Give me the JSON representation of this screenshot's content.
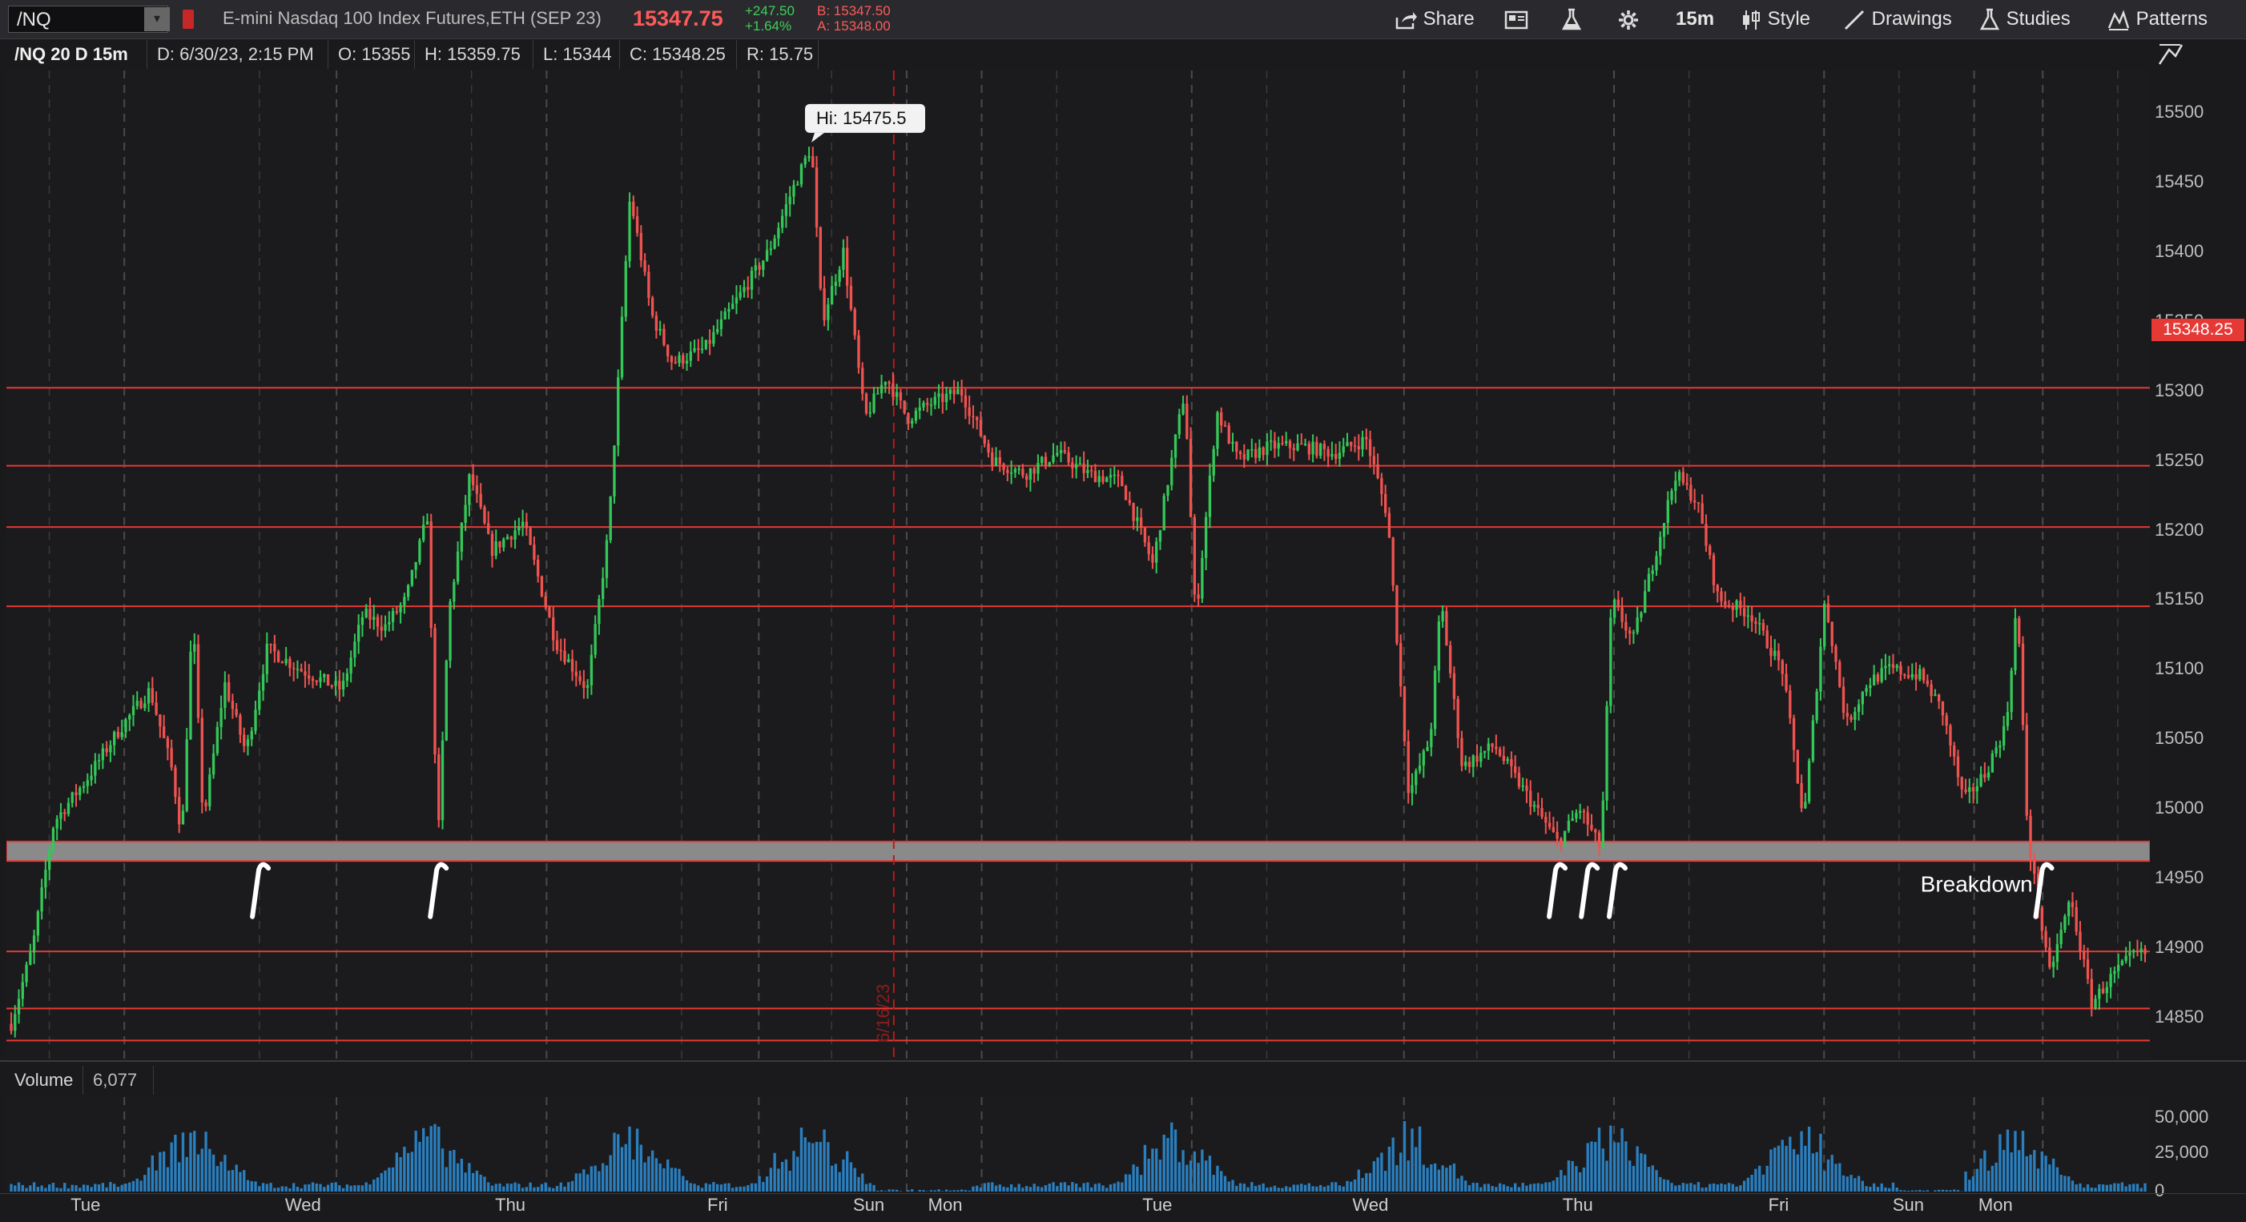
{
  "toolbar": {
    "symbol": "/NQ",
    "description": "E-mini Nasdaq 100 Index Futures,ETH (SEP 23)",
    "last_price": "15347.75",
    "net_change": "+247.50",
    "pct_change": "+1.64%",
    "bid": "B: 15347.50",
    "ask": "A: 15348.00",
    "share_label": "Share",
    "timeframe_label": "15m",
    "style_label": "Style",
    "drawings_label": "Drawings",
    "studies_label": "Studies",
    "patterns_label": "Patterns"
  },
  "info": {
    "chart_label": "/NQ 20 D 15m",
    "date": "D: 6/30/23, 2:15 PM",
    "open": "O: 15355",
    "high": "H: 15359.75",
    "low": "L: 15344",
    "close": "C: 15348.25",
    "range": "R: 15.75"
  },
  "volume_pane": {
    "label": "Volume",
    "value": "6,077",
    "axis_labels": [
      "50,000",
      "25,000",
      "0"
    ]
  },
  "chart_data": {
    "type": "candlestick",
    "price_axis": [
      "15500",
      "15450",
      "15400",
      "15350",
      "15300",
      "15250",
      "15200",
      "15150",
      "15100",
      "15050",
      "15000",
      "14950",
      "14900",
      "14850"
    ],
    "ylim": [
      14820,
      15530
    ],
    "current_price_label": "15348.25",
    "day_labels": [
      "Tue",
      "Wed",
      "Thu",
      "Fri",
      "Sun",
      "Mon",
      "Tue",
      "Wed",
      "Thu",
      "Fri",
      "Sun",
      "Mon"
    ],
    "horizontal_levels": [
      15302,
      15246,
      15202,
      15145,
      14897,
      14856,
      14833
    ],
    "support_zone": [
      14962,
      14976
    ],
    "session_marker": "6/16/23",
    "high_annotation": "Hi: 15475.5",
    "annotations": [
      "Breakdown"
    ],
    "path_points": [
      [
        0,
        14845
      ],
      [
        0.01,
        14900
      ],
      [
        0.02,
        14990
      ],
      [
        0.035,
        15020
      ],
      [
        0.05,
        15055
      ],
      [
        0.065,
        15085
      ],
      [
        0.075,
        15030
      ],
      [
        0.08,
        14980
      ],
      [
        0.085,
        15140
      ],
      [
        0.09,
        14990
      ],
      [
        0.1,
        15090
      ],
      [
        0.11,
        15040
      ],
      [
        0.12,
        15115
      ],
      [
        0.135,
        15100
      ],
      [
        0.155,
        15085
      ],
      [
        0.165,
        15140
      ],
      [
        0.175,
        15130
      ],
      [
        0.185,
        15150
      ],
      [
        0.195,
        15210
      ],
      [
        0.2,
        14975
      ],
      [
        0.205,
        15140
      ],
      [
        0.215,
        15240
      ],
      [
        0.225,
        15185
      ],
      [
        0.24,
        15205
      ],
      [
        0.255,
        15120
      ],
      [
        0.27,
        15085
      ],
      [
        0.28,
        15200
      ],
      [
        0.29,
        15440
      ],
      [
        0.3,
        15355
      ],
      [
        0.31,
        15320
      ],
      [
        0.325,
        15330
      ],
      [
        0.34,
        15365
      ],
      [
        0.355,
        15400
      ],
      [
        0.365,
        15440
      ],
      [
        0.375,
        15476
      ],
      [
        0.38,
        15350
      ],
      [
        0.39,
        15400
      ],
      [
        0.4,
        15280
      ],
      [
        0.41,
        15310
      ],
      [
        0.42,
        15280
      ],
      [
        0.43,
        15290
      ],
      [
        0.445,
        15300
      ],
      [
        0.46,
        15250
      ],
      [
        0.475,
        15240
      ],
      [
        0.49,
        15255
      ],
      [
        0.505,
        15240
      ],
      [
        0.52,
        15235
      ],
      [
        0.535,
        15175
      ],
      [
        0.545,
        15260
      ],
      [
        0.55,
        15300
      ],
      [
        0.555,
        15135
      ],
      [
        0.565,
        15285
      ],
      [
        0.575,
        15250
      ],
      [
        0.59,
        15260
      ],
      [
        0.605,
        15260
      ],
      [
        0.62,
        15255
      ],
      [
        0.635,
        15265
      ],
      [
        0.645,
        15210
      ],
      [
        0.655,
        15010
      ],
      [
        0.665,
        15050
      ],
      [
        0.67,
        15150
      ],
      [
        0.68,
        15030
      ],
      [
        0.695,
        15045
      ],
      [
        0.71,
        15010
      ],
      [
        0.725,
        14975
      ],
      [
        0.735,
        15000
      ],
      [
        0.745,
        14970
      ],
      [
        0.75,
        15150
      ],
      [
        0.76,
        15120
      ],
      [
        0.77,
        15180
      ],
      [
        0.78,
        15240
      ],
      [
        0.79,
        15220
      ],
      [
        0.8,
        15150
      ],
      [
        0.815,
        15140
      ],
      [
        0.83,
        15100
      ],
      [
        0.84,
        14990
      ],
      [
        0.85,
        15150
      ],
      [
        0.86,
        15060
      ],
      [
        0.87,
        15090
      ],
      [
        0.88,
        15100
      ],
      [
        0.895,
        15095
      ],
      [
        0.905,
        15070
      ],
      [
        0.915,
        15005
      ],
      [
        0.925,
        15025
      ],
      [
        0.935,
        15060
      ],
      [
        0.94,
        15150
      ],
      [
        0.945,
        14980
      ],
      [
        0.955,
        14880
      ],
      [
        0.965,
        14935
      ],
      [
        0.975,
        14860
      ],
      [
        0.985,
        14880
      ],
      [
        0.995,
        14895
      ]
    ],
    "volume_axis": [
      "50,000",
      "25,000",
      "0"
    ]
  }
}
